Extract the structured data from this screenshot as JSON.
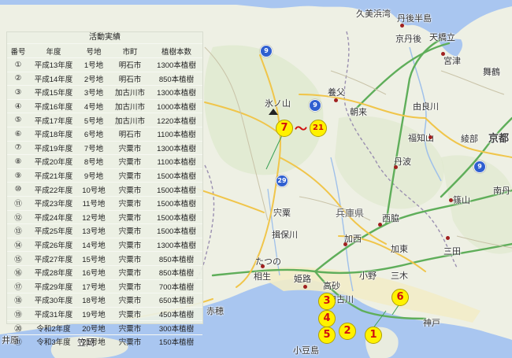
{
  "map": {
    "places": {
      "kumihama": "久美浜湾",
      "tango_hanto": "丹後半島",
      "kyotango": "京丹後",
      "amanohashidate": "天橋立",
      "miyazu": "宮津",
      "maizuru": "舞鶴",
      "hyonosen": "氷ノ山",
      "yabu": "養父",
      "asago": "朝来",
      "yuragawa": "由良川",
      "fukuchiyama": "福知山",
      "ayabe": "綾部",
      "kyoto": "京都",
      "tanba": "丹波",
      "sasayama": "篠山",
      "nantan": "南丹",
      "shiso": "宍粟",
      "ibogawa": "揖保川",
      "hyogo": "兵庫県",
      "nishiwaki": "西脇",
      "kasai": "加西",
      "katou": "加東",
      "sanda": "三田",
      "tatsuno": "たつの",
      "aioi": "相生",
      "himeji": "姫路",
      "takasago": "高砂",
      "kakogawa": "加古川",
      "ono": "小野",
      "miki": "三木",
      "kobe": "神戸",
      "ako": "赤穂",
      "shodoshima": "小豆島",
      "ihara": "井原",
      "kasaoka": "笠岡"
    },
    "route_shields": [
      "9",
      "9",
      "29",
      "9"
    ],
    "markers": [
      "7",
      "21",
      "3",
      "4",
      "5",
      "2",
      "1",
      "6"
    ],
    "range_symbol": "～"
  },
  "activity": {
    "title": "活動実績",
    "headers": [
      "番号",
      "年度",
      "号地",
      "市町",
      "植樹本数"
    ],
    "rows": [
      [
        "①",
        "平成13年度",
        "1号地",
        "明石市",
        "1300本植樹"
      ],
      [
        "②",
        "平成14年度",
        "2号地",
        "明石市",
        "850本植樹"
      ],
      [
        "③",
        "平成15年度",
        "3号地",
        "加古川市",
        "1300本植樹"
      ],
      [
        "④",
        "平成16年度",
        "4号地",
        "加古川市",
        "1000本植樹"
      ],
      [
        "⑤",
        "平成17年度",
        "5号地",
        "加古川市",
        "1220本植樹"
      ],
      [
        "⑥",
        "平成18年度",
        "6号地",
        "明石市",
        "1100本植樹"
      ],
      [
        "⑦",
        "平成19年度",
        "7号地",
        "宍粟市",
        "1300本植樹"
      ],
      [
        "⑧",
        "平成20年度",
        "8号地",
        "宍粟市",
        "1100本植樹"
      ],
      [
        "⑨",
        "平成21年度",
        "9号地",
        "宍粟市",
        "1500本植樹"
      ],
      [
        "⑩",
        "平成22年度",
        "10号地",
        "宍粟市",
        "1500本植樹"
      ],
      [
        "⑪",
        "平成23年度",
        "11号地",
        "宍粟市",
        "1500本植樹"
      ],
      [
        "⑫",
        "平成24年度",
        "12号地",
        "宍粟市",
        "1500本植樹"
      ],
      [
        "⑬",
        "平成25年度",
        "13号地",
        "宍粟市",
        "1500本植樹"
      ],
      [
        "⑭",
        "平成26年度",
        "14号地",
        "宍粟市",
        "1300本植樹"
      ],
      [
        "⑮",
        "平成27年度",
        "15号地",
        "宍粟市",
        "850本植樹"
      ],
      [
        "⑯",
        "平成28年度",
        "16号地",
        "宍粟市",
        "850本植樹"
      ],
      [
        "⑰",
        "平成29年度",
        "17号地",
        "宍粟市",
        "700本植樹"
      ],
      [
        "⑱",
        "平成30年度",
        "18号地",
        "宍粟市",
        "650本植樹"
      ],
      [
        "⑲",
        "平成31年度",
        "19号地",
        "宍粟市",
        "450本植樹"
      ],
      [
        "⑳",
        "令和2年度",
        "20号地",
        "宍粟市",
        "300本植樹"
      ],
      [
        "㉑",
        "令和3年度",
        "21号地",
        "宍粟市",
        "150本植樹"
      ]
    ]
  }
}
